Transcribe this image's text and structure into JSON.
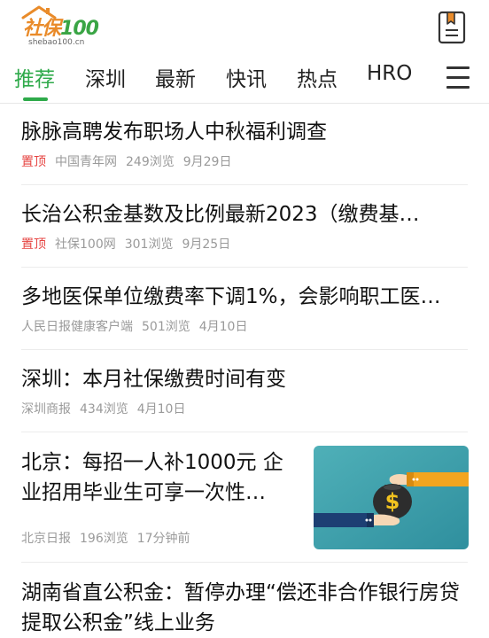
{
  "header": {
    "logo_text": "社保",
    "logo_num": "100",
    "logo_domain": "shebao100.cn",
    "bookmark_icon": "bookmark-icon"
  },
  "tabs": [
    {
      "label": "推荐",
      "active": true
    },
    {
      "label": "深圳",
      "active": false
    },
    {
      "label": "最新",
      "active": false
    },
    {
      "label": "快讯",
      "active": false
    },
    {
      "label": "热点",
      "active": false
    },
    {
      "label": "HRO",
      "active": false
    }
  ],
  "menu_icon": "hamburger-menu-icon",
  "articles": [
    {
      "title": "脉脉高聘发布职场人中秋福利调查",
      "tag": "置顶",
      "source": "中国青年网",
      "views": "249浏览",
      "time": "9月29日"
    },
    {
      "title": "长治公积金基数及比例最新2023（缴费基…",
      "tag": "置顶",
      "source": "社保100网",
      "views": "301浏览",
      "time": "9月25日"
    },
    {
      "title": "多地医保单位缴费率下调1%，会影响职工医…",
      "source": "人民日报健康客户端",
      "views": "501浏览",
      "time": "4月10日"
    },
    {
      "title": "深圳：本月社保缴费时间有变",
      "source": "深圳商报",
      "views": "434浏览",
      "time": "4月10日"
    },
    {
      "title": "北京：每招一人补1000元 企业招用毕业生可享一次性…",
      "source": "北京日报",
      "views": "196浏览",
      "time": "17分钟前",
      "thumbnail": "money-bag-handover-illustration"
    },
    {
      "title": "湖南省直公积金：暂停办理“偿还非合作银行房贷提取公积金”线上业务"
    }
  ],
  "colors": {
    "accent": "#2eaa4a",
    "top_tag": "#e64340",
    "meta": "#9a9a9a",
    "logo_orange": "#e98b2a"
  }
}
